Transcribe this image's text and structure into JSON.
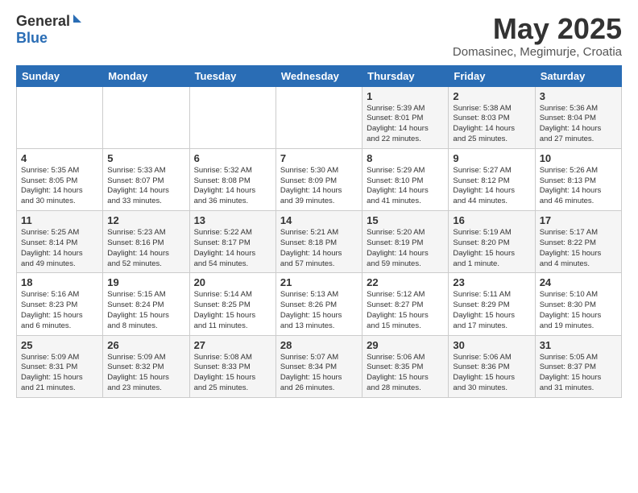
{
  "header": {
    "logo_general": "General",
    "logo_blue": "Blue",
    "month": "May 2025",
    "location": "Domasinec, Megimurje, Croatia"
  },
  "weekdays": [
    "Sunday",
    "Monday",
    "Tuesday",
    "Wednesday",
    "Thursday",
    "Friday",
    "Saturday"
  ],
  "weeks": [
    [
      {
        "day": "",
        "info": ""
      },
      {
        "day": "",
        "info": ""
      },
      {
        "day": "",
        "info": ""
      },
      {
        "day": "",
        "info": ""
      },
      {
        "day": "1",
        "info": "Sunrise: 5:39 AM\nSunset: 8:01 PM\nDaylight: 14 hours\nand 22 minutes."
      },
      {
        "day": "2",
        "info": "Sunrise: 5:38 AM\nSunset: 8:03 PM\nDaylight: 14 hours\nand 25 minutes."
      },
      {
        "day": "3",
        "info": "Sunrise: 5:36 AM\nSunset: 8:04 PM\nDaylight: 14 hours\nand 27 minutes."
      }
    ],
    [
      {
        "day": "4",
        "info": "Sunrise: 5:35 AM\nSunset: 8:05 PM\nDaylight: 14 hours\nand 30 minutes."
      },
      {
        "day": "5",
        "info": "Sunrise: 5:33 AM\nSunset: 8:07 PM\nDaylight: 14 hours\nand 33 minutes."
      },
      {
        "day": "6",
        "info": "Sunrise: 5:32 AM\nSunset: 8:08 PM\nDaylight: 14 hours\nand 36 minutes."
      },
      {
        "day": "7",
        "info": "Sunrise: 5:30 AM\nSunset: 8:09 PM\nDaylight: 14 hours\nand 39 minutes."
      },
      {
        "day": "8",
        "info": "Sunrise: 5:29 AM\nSunset: 8:10 PM\nDaylight: 14 hours\nand 41 minutes."
      },
      {
        "day": "9",
        "info": "Sunrise: 5:27 AM\nSunset: 8:12 PM\nDaylight: 14 hours\nand 44 minutes."
      },
      {
        "day": "10",
        "info": "Sunrise: 5:26 AM\nSunset: 8:13 PM\nDaylight: 14 hours\nand 46 minutes."
      }
    ],
    [
      {
        "day": "11",
        "info": "Sunrise: 5:25 AM\nSunset: 8:14 PM\nDaylight: 14 hours\nand 49 minutes."
      },
      {
        "day": "12",
        "info": "Sunrise: 5:23 AM\nSunset: 8:16 PM\nDaylight: 14 hours\nand 52 minutes."
      },
      {
        "day": "13",
        "info": "Sunrise: 5:22 AM\nSunset: 8:17 PM\nDaylight: 14 hours\nand 54 minutes."
      },
      {
        "day": "14",
        "info": "Sunrise: 5:21 AM\nSunset: 8:18 PM\nDaylight: 14 hours\nand 57 minutes."
      },
      {
        "day": "15",
        "info": "Sunrise: 5:20 AM\nSunset: 8:19 PM\nDaylight: 14 hours\nand 59 minutes."
      },
      {
        "day": "16",
        "info": "Sunrise: 5:19 AM\nSunset: 8:20 PM\nDaylight: 15 hours\nand 1 minute."
      },
      {
        "day": "17",
        "info": "Sunrise: 5:17 AM\nSunset: 8:22 PM\nDaylight: 15 hours\nand 4 minutes."
      }
    ],
    [
      {
        "day": "18",
        "info": "Sunrise: 5:16 AM\nSunset: 8:23 PM\nDaylight: 15 hours\nand 6 minutes."
      },
      {
        "day": "19",
        "info": "Sunrise: 5:15 AM\nSunset: 8:24 PM\nDaylight: 15 hours\nand 8 minutes."
      },
      {
        "day": "20",
        "info": "Sunrise: 5:14 AM\nSunset: 8:25 PM\nDaylight: 15 hours\nand 11 minutes."
      },
      {
        "day": "21",
        "info": "Sunrise: 5:13 AM\nSunset: 8:26 PM\nDaylight: 15 hours\nand 13 minutes."
      },
      {
        "day": "22",
        "info": "Sunrise: 5:12 AM\nSunset: 8:27 PM\nDaylight: 15 hours\nand 15 minutes."
      },
      {
        "day": "23",
        "info": "Sunrise: 5:11 AM\nSunset: 8:29 PM\nDaylight: 15 hours\nand 17 minutes."
      },
      {
        "day": "24",
        "info": "Sunrise: 5:10 AM\nSunset: 8:30 PM\nDaylight: 15 hours\nand 19 minutes."
      }
    ],
    [
      {
        "day": "25",
        "info": "Sunrise: 5:09 AM\nSunset: 8:31 PM\nDaylight: 15 hours\nand 21 minutes."
      },
      {
        "day": "26",
        "info": "Sunrise: 5:09 AM\nSunset: 8:32 PM\nDaylight: 15 hours\nand 23 minutes."
      },
      {
        "day": "27",
        "info": "Sunrise: 5:08 AM\nSunset: 8:33 PM\nDaylight: 15 hours\nand 25 minutes."
      },
      {
        "day": "28",
        "info": "Sunrise: 5:07 AM\nSunset: 8:34 PM\nDaylight: 15 hours\nand 26 minutes."
      },
      {
        "day": "29",
        "info": "Sunrise: 5:06 AM\nSunset: 8:35 PM\nDaylight: 15 hours\nand 28 minutes."
      },
      {
        "day": "30",
        "info": "Sunrise: 5:06 AM\nSunset: 8:36 PM\nDaylight: 15 hours\nand 30 minutes."
      },
      {
        "day": "31",
        "info": "Sunrise: 5:05 AM\nSunset: 8:37 PM\nDaylight: 15 hours\nand 31 minutes."
      }
    ]
  ]
}
